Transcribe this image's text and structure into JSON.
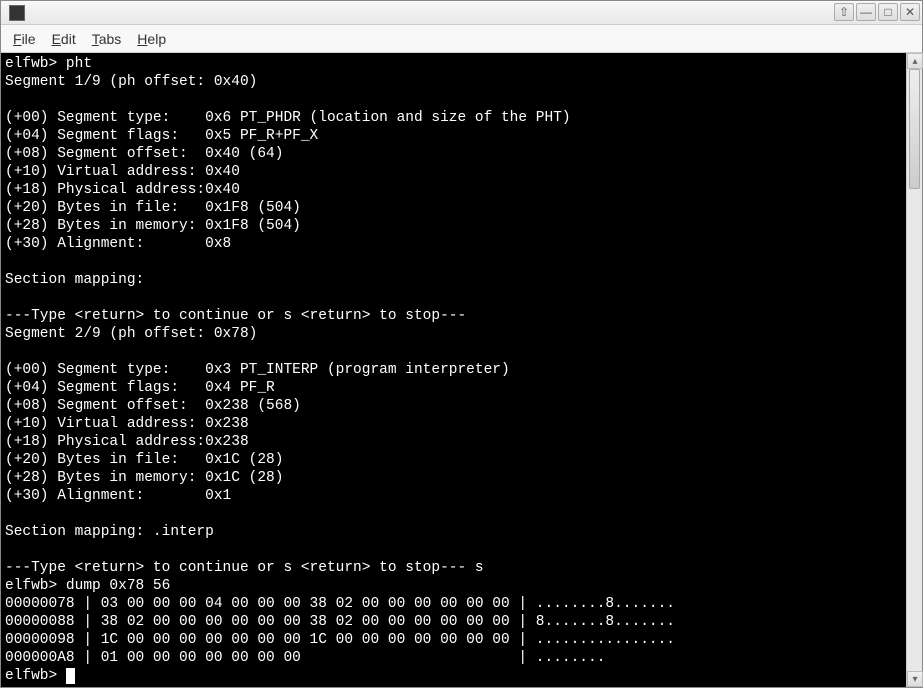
{
  "menu": {
    "file": "File",
    "file_u": "F",
    "edit": "Edit",
    "edit_u": "E",
    "tabs": "Tabs",
    "tabs_u": "T",
    "help": "Help",
    "help_u": "H"
  },
  "terminal": {
    "lines": [
      "elfwb> pht",
      "Segment 1/9 (ph offset: 0x40)",
      "",
      "(+00) Segment type:    0x6 PT_PHDR (location and size of the PHT)",
      "(+04) Segment flags:   0x5 PF_R+PF_X",
      "(+08) Segment offset:  0x40 (64)",
      "(+10) Virtual address: 0x40",
      "(+18) Physical address:0x40",
      "(+20) Bytes in file:   0x1F8 (504)",
      "(+28) Bytes in memory: 0x1F8 (504)",
      "(+30) Alignment:       0x8",
      "",
      "Section mapping:",
      "",
      "---Type <return> to continue or s <return> to stop---",
      "Segment 2/9 (ph offset: 0x78)",
      "",
      "(+00) Segment type:    0x3 PT_INTERP (program interpreter)",
      "(+04) Segment flags:   0x4 PF_R",
      "(+08) Segment offset:  0x238 (568)",
      "(+10) Virtual address: 0x238",
      "(+18) Physical address:0x238",
      "(+20) Bytes in file:   0x1C (28)",
      "(+28) Bytes in memory: 0x1C (28)",
      "(+30) Alignment:       0x1",
      "",
      "Section mapping: .interp",
      "",
      "---Type <return> to continue or s <return> to stop--- s",
      "elfwb> dump 0x78 56",
      "00000078 | 03 00 00 00 04 00 00 00 38 02 00 00 00 00 00 00 | ........8.......",
      "00000088 | 38 02 00 00 00 00 00 00 38 02 00 00 00 00 00 00 | 8.......8.......",
      "00000098 | 1C 00 00 00 00 00 00 00 1C 00 00 00 00 00 00 00 | ................",
      "000000A8 | 01 00 00 00 00 00 00 00                         | ........",
      "elfwb> "
    ]
  }
}
